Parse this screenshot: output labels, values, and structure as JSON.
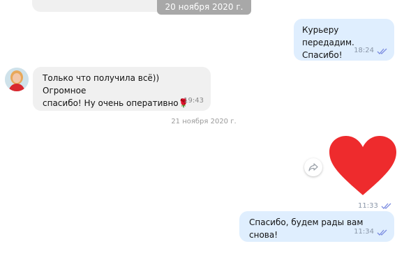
{
  "dates": {
    "top_pill": "20 ноября 2020 г.",
    "separator": "21 ноября 2020 г."
  },
  "messages": [
    {
      "direction": "out",
      "text_line1": "Курьеру передадим.",
      "text_line2": "Спасибо!",
      "time": "18:24",
      "read": true
    },
    {
      "direction": "in",
      "text_line1": "Только что получила всё)) Огромное",
      "text_line2": "спасибо! Ну очень оперативно",
      "emoji": "🌹",
      "time": "19:43"
    },
    {
      "direction": "out",
      "sticker": "heart",
      "time": "11:33",
      "read": true
    },
    {
      "direction": "out",
      "text": "Спасибо, будем рады вам снова!",
      "time": "11:34",
      "read": true
    }
  ],
  "colors": {
    "outgoing_bubble": "#dfeefe",
    "incoming_bubble": "#f0f0f0",
    "heart": "#ee2b2d",
    "read_checks": "#7b8ce0"
  },
  "icons": {
    "read_status": "double-check-icon",
    "share": "share-icon",
    "sticker": "heart-icon"
  }
}
